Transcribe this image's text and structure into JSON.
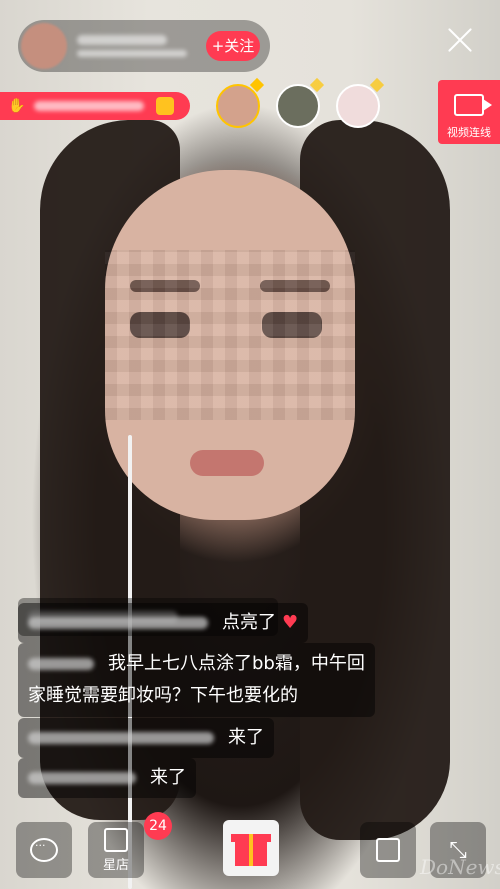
{
  "header": {
    "follow_label": "+关注",
    "video_link_label": "视频连线"
  },
  "comments": [
    {
      "text": "点亮了"
    },
    {
      "text": "我早上七八点涂了bb霜，中午回"
    },
    {
      "text": "家睡觉需要卸妆吗？下午也要化的"
    },
    {
      "text": "来了"
    },
    {
      "text": "来了"
    }
  ],
  "bottom_bar": {
    "star_shop_label": "星店",
    "star_shop_badge": "24"
  },
  "watermark": "DoNews",
  "colors": {
    "accent": "#ff3b52",
    "gold": "#ffc400"
  },
  "icons": [
    "close-icon",
    "chat-icon",
    "star-shop-icon",
    "gift-icon",
    "share-icon",
    "expand-icon",
    "video-camera-icon",
    "heart-icon"
  ]
}
